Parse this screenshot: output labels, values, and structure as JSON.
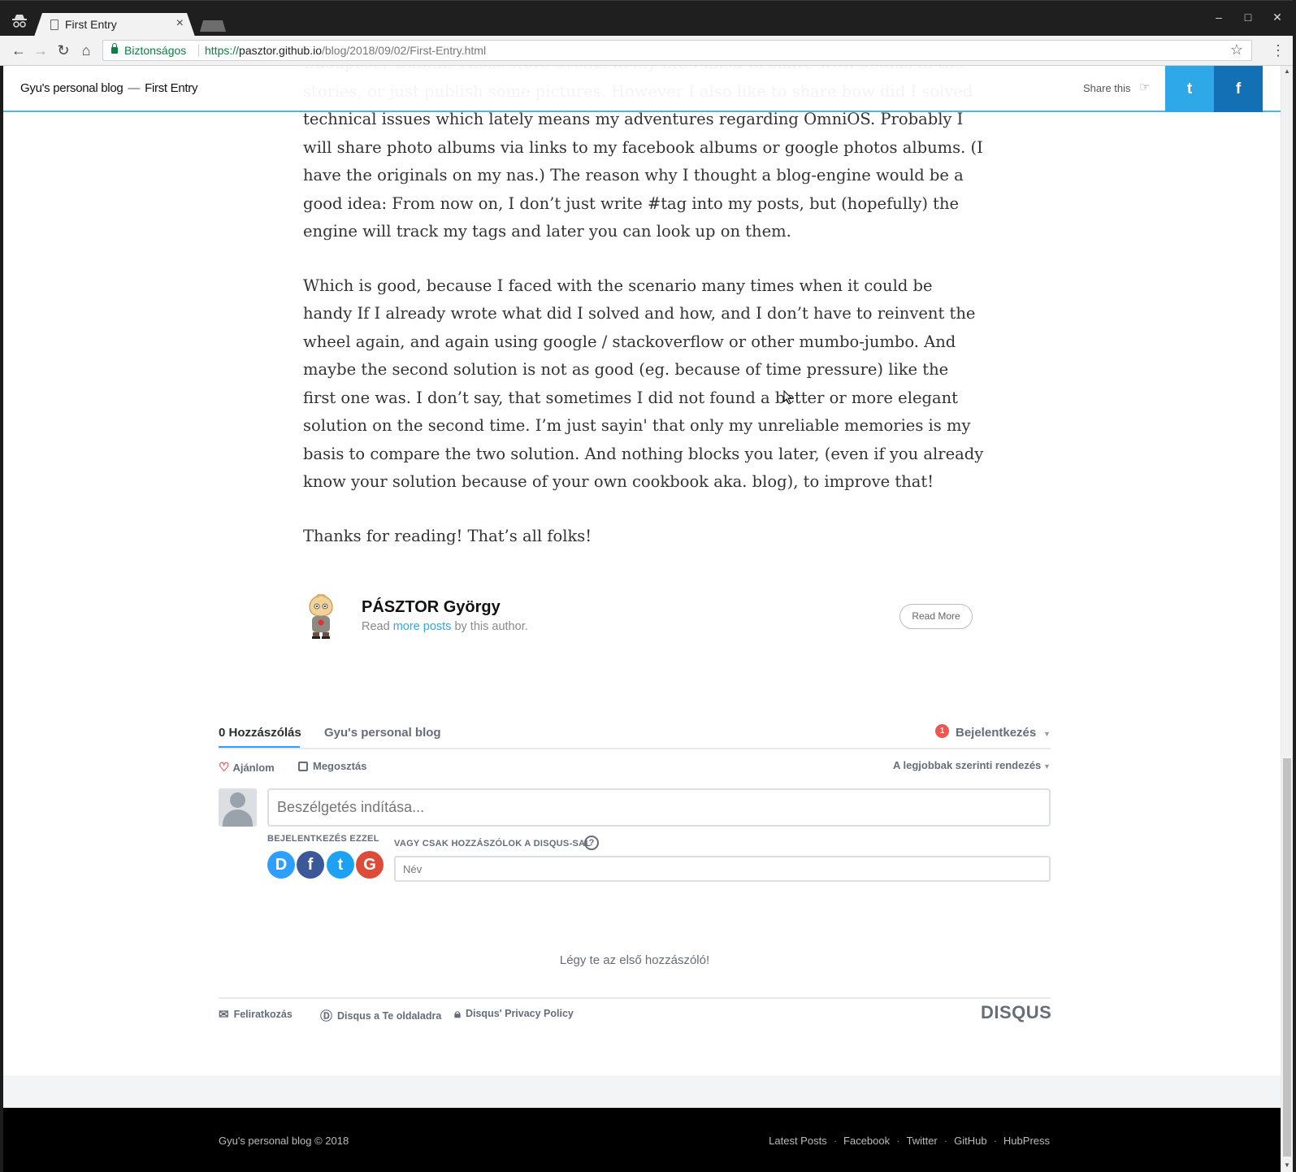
{
  "browser": {
    "tab_title": "First Entry",
    "tab_close": "×",
    "secure_label": "Biztonságos",
    "url_scheme": "https://",
    "url_host": "pasztor.github.io",
    "url_path": "/blog/2018/09/02/First-Entry.html",
    "window_buttons": [
      "–",
      "□",
      "✕"
    ],
    "nav_icons": [
      "back-icon",
      "forward-icon",
      "reload-icon",
      "home-icon",
      "bookmark-star-icon",
      "menu-icon"
    ]
  },
  "header": {
    "blog_name": "Gyu's personal blog",
    "separator": "—",
    "post_title": "First Entry",
    "share_label": "Share this",
    "twitter_glyph": "t",
    "facebook_glyph": "f",
    "twitter_color": "#2fa8e8",
    "facebook_color": "#1470b4"
  },
  "article": {
    "paragraphs": [
      "Budapest / Dublin. Those were events in my life I liked to share with details in the stories, or just publish some pictures. However I also like to share how did I solved technical issues which lately means my adventures regarding OmniOS. Probably I will share photo albums via links to my facebook albums or google photos albums. (I have the originals on my nas.) The reason why I thought a blog-engine would be a good idea: From now on, I don’t just write #tag into my posts, but (hopefully) the engine will track my tags and later you can look up on them.",
      "Which is good, because I faced with the scenario many times when it could be handy If I already wrote what did I solved and how, and I don’t have to reinvent the wheel again, and again using google / stackoverflow or other mumbo-jumbo. And maybe the second solution is not as good (eg. because of time pressure) like the first one was. I don’t say, that sometimes I did not found a better or more elegant solution on the second time. I’m just sayin' that only my unreliable memories is my basis to compare the two solution. And nothing blocks you later, (even if you already know your solution because of your own cookbook aka. blog), to improve that!",
      "Thanks for reading! That’s all folks!"
    ]
  },
  "author": {
    "name": "PÁSZTOR György",
    "read_prefix": "Read",
    "more_posts_link": "more posts",
    "read_suffix": "by this author.",
    "read_more_button": "Read More"
  },
  "disqus": {
    "tab_count": "0 Hozzászólás",
    "tab_site": "Gyu's personal blog",
    "notification_count": "1",
    "login": "Bejelentkezés",
    "like": "Ajánlom",
    "share": "Megosztás",
    "sort": "A legjobbak szerinti rendezés",
    "comment_placeholder": "Beszélgetés indítása...",
    "login_with": "BEJELENTKEZÉS EZZEL",
    "or_guest": "VAGY CSAK HOZZÁSZÓLOK A DISQUS-SAL",
    "help": "?",
    "name_placeholder": "Név",
    "social": [
      {
        "glyph": "D",
        "color": "#2e9fff",
        "icon": "disqus-login-icon"
      },
      {
        "glyph": "f",
        "color": "#3b5998",
        "icon": "facebook-login-icon"
      },
      {
        "glyph": "t",
        "color": "#1da1f2",
        "icon": "twitter-login-icon"
      },
      {
        "glyph": "G",
        "color": "#dd4b39",
        "icon": "google-login-icon"
      }
    ],
    "empty_state": "Légy te az első hozzászóló!",
    "footer_subscribe": "Feliratkozás",
    "footer_add": "Disqus a Te oldaladra",
    "footer_privacy": "Disqus' Privacy Policy",
    "logo": "DISQUS"
  },
  "footer": {
    "copyright": "Gyu's personal blog © 2018",
    "links": [
      "Latest Posts",
      "Facebook",
      "Twitter",
      "GitHub",
      "HubPress"
    ]
  }
}
